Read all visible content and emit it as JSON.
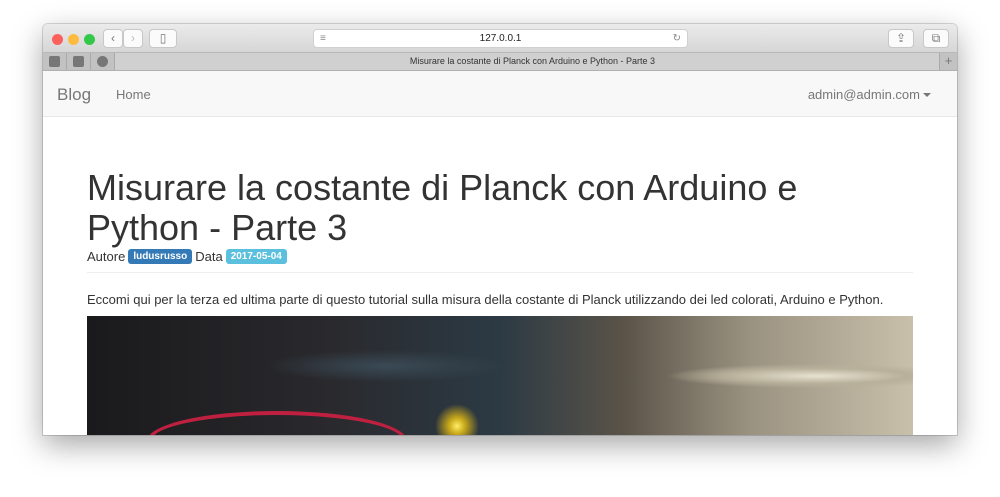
{
  "browser": {
    "url": "127.0.0.1",
    "tab_title": "Misurare la costante di Planck con Arduino e Python - Parte 3"
  },
  "nav": {
    "brand": "Blog",
    "home": "Home",
    "user": "admin@admin.com"
  },
  "post": {
    "title": "Misurare la costante di Planck con Arduino e Python - Parte 3",
    "author_label": "Autore",
    "author": "ludusrusso",
    "date_label": "Data",
    "date": "2017-05-04",
    "intro": "Eccomi qui per la terza ed ultima parte di questo tutorial sulla misura della costante di Planck utilizzando dei led colorati, Arduino e Python."
  },
  "colors": {
    "author_badge": "#337ab7",
    "date_badge": "#5bc0de"
  }
}
